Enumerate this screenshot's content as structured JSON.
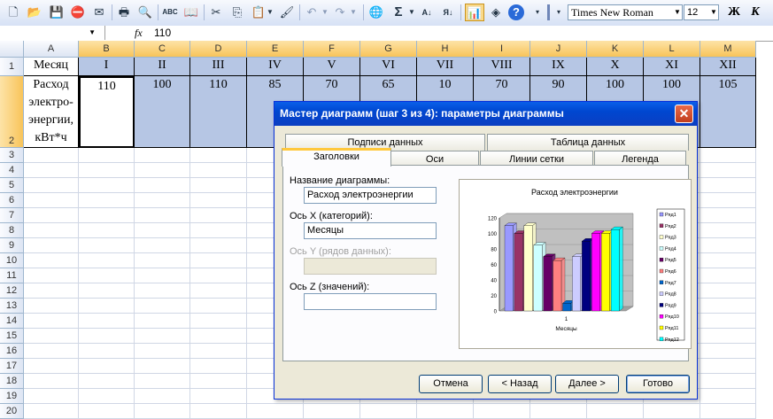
{
  "toolbar": {
    "icons": [
      "new-icon",
      "open-icon",
      "save-icon",
      "permission-icon",
      "print-preview-icon",
      "print-icon",
      "preview-icon",
      "spelling-icon",
      "research-icon",
      "cut-icon",
      "copy-icon",
      "paste-icon",
      "format-painter-icon",
      "undo-icon",
      "redo-icon",
      "hyperlink-icon",
      "autosum-icon",
      "sort-asc-icon",
      "sort-desc-icon",
      "chart-wizard-icon",
      "drawing-icon",
      "help-icon"
    ],
    "font_name": "Times New Roman",
    "font_size": "12",
    "bold": "Ж",
    "italic": "К",
    "glyphs": {
      "sum": "Σ",
      "help": "?",
      "undo": "↶",
      "redo": "↷",
      "cut": "✂",
      "sort_asc": "А↓",
      "sort_desc": "Я↓",
      "abc": "ABC"
    }
  },
  "formula_bar": {
    "name_box": "",
    "fx": "fx",
    "value": "110"
  },
  "sheet": {
    "columns": [
      "A",
      "B",
      "C",
      "D",
      "E",
      "F",
      "G",
      "H",
      "I",
      "J",
      "K",
      "L",
      "M"
    ],
    "rows": [
      "1",
      "2",
      "3",
      "4",
      "5",
      "6",
      "7",
      "8",
      "9",
      "10",
      "11",
      "12",
      "13",
      "14",
      "15",
      "16",
      "17",
      "18",
      "19",
      "20"
    ],
    "row1": [
      "Месяц",
      "I",
      "II",
      "III",
      "IV",
      "V",
      "VI",
      "VII",
      "VIII",
      "IX",
      "X",
      "XI",
      "XII"
    ],
    "row2_label_lines": [
      "Расход",
      "электро-",
      "энергии,",
      "кВт*ч"
    ],
    "row2": [
      "110",
      "100",
      "110",
      "85",
      "70",
      "65",
      "10",
      "70",
      "90",
      "100",
      "100",
      "105"
    ]
  },
  "dialog": {
    "title": "Мастер диаграмм (шаг 3 из 4): параметры диаграммы",
    "close": "✕",
    "tabs_back": [
      "Подписи данных",
      "Таблица данных"
    ],
    "tabs_front": [
      "Заголовки",
      "Оси",
      "Линии сетки",
      "Легенда"
    ],
    "fields": {
      "chart_title_label": "Название диаграммы:",
      "chart_title_value": "Расход электроэнергии",
      "x_axis_label": "Ось X (категорий):",
      "x_axis_value": "Месяцы",
      "y_axis_label": "Ось Y (рядов данных):",
      "y_axis_value": "",
      "z_axis_label": "Ось Z (значений):",
      "z_axis_value": ""
    },
    "buttons": {
      "cancel": "Отмена",
      "back": "< Назад",
      "next": "Далее >",
      "finish": "Готово"
    }
  },
  "chart_data": {
    "type": "bar",
    "title": "Расход электроэнергии",
    "xlabel": "Месяцы",
    "ylabel": "",
    "categories": [
      "1"
    ],
    "ylim": [
      0,
      120
    ],
    "yticks": [
      0,
      20,
      40,
      60,
      80,
      100,
      120
    ],
    "series": [
      {
        "name": "Ряд1",
        "values": [
          110
        ],
        "color": "#9999ff"
      },
      {
        "name": "Ряд2",
        "values": [
          100
        ],
        "color": "#993366"
      },
      {
        "name": "Ряд3",
        "values": [
          110
        ],
        "color": "#ffffcc"
      },
      {
        "name": "Ряд4",
        "values": [
          85
        ],
        "color": "#ccffff"
      },
      {
        "name": "Ряд5",
        "values": [
          70
        ],
        "color": "#660066"
      },
      {
        "name": "Ряд6",
        "values": [
          65
        ],
        "color": "#ff8080"
      },
      {
        "name": "Ряд7",
        "values": [
          10
        ],
        "color": "#0066cc"
      },
      {
        "name": "Ряд8",
        "values": [
          70
        ],
        "color": "#ccccff"
      },
      {
        "name": "Ряд9",
        "values": [
          90
        ],
        "color": "#000080"
      },
      {
        "name": "Ряд10",
        "values": [
          100
        ],
        "color": "#ff00ff"
      },
      {
        "name": "Ряд11",
        "values": [
          100
        ],
        "color": "#ffff00"
      },
      {
        "name": "Ряд12",
        "values": [
          105
        ],
        "color": "#00ffff"
      }
    ],
    "legend": "right"
  }
}
